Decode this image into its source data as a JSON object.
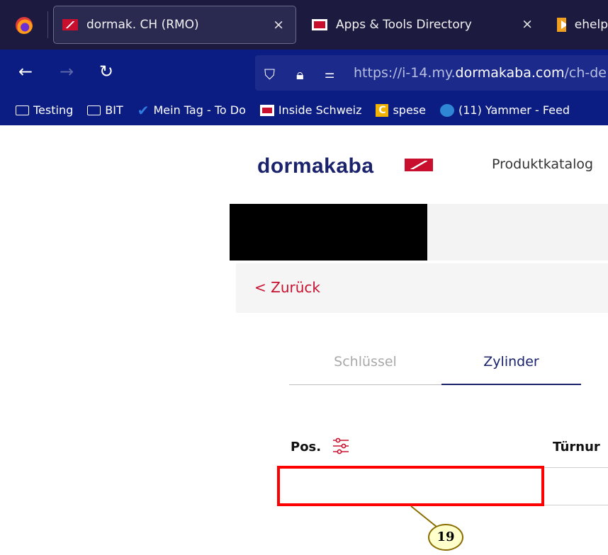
{
  "browser": {
    "tabs": [
      {
        "label": "dormak. CH (RMO)",
        "active": true
      },
      {
        "label": "Apps & Tools Directory",
        "active": false
      },
      {
        "label": "ehelp",
        "active": false
      }
    ],
    "close_glyph": "×",
    "url_prefix": "https://i-14.my.",
    "url_domain": "dormakaba.com",
    "url_suffix": "/ch-de",
    "bookmarks": [
      "Testing",
      "BIT",
      "Mein Tag - To Do",
      "Inside Schweiz",
      "spese",
      "(11) Yammer - Feed"
    ]
  },
  "page": {
    "logo_text": "dormakaba",
    "nav_link": "Produktkatalog",
    "back_label": "< Zurück",
    "tabs": [
      "Schlüssel",
      "Zylinder"
    ],
    "columns": [
      "Pos.",
      "Türnur"
    ]
  },
  "annotation": {
    "callout_number": "19",
    "highlight_color": "#ff0000"
  },
  "colors": {
    "brand_navy": "#19226b",
    "brand_red": "#c8102e",
    "browser_bar": "#0b1d82"
  }
}
